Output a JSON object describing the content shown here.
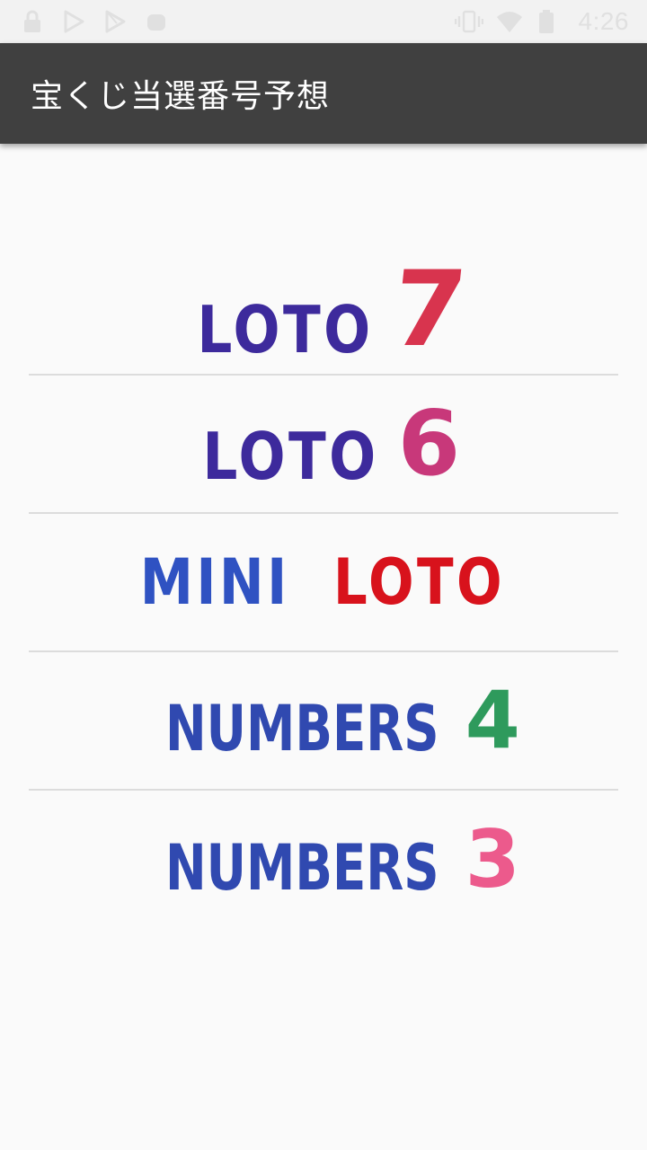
{
  "status_bar": {
    "time": "4:26",
    "left_icons": [
      "lock-icon",
      "play-store-icon",
      "play-store-icon",
      "android-icon"
    ],
    "right_icons": [
      "vibrate-icon",
      "wifi-icon",
      "battery-icon"
    ],
    "icon_color": "#e0e0e0"
  },
  "app_bar": {
    "title": "宝くじ当選番号予想",
    "background": "#404040"
  },
  "menu": {
    "items": [
      {
        "id": "loto7",
        "word": "LOTO",
        "suffix": "7",
        "word_color": "#3d2a9c",
        "suffix_color": "#d8344e"
      },
      {
        "id": "loto6",
        "word": "LOTO",
        "suffix": "6",
        "word_color": "#3d2a9c",
        "suffix_color": "#c8387a"
      },
      {
        "id": "miniloto",
        "word": "MINI",
        "suffix": "LOTO",
        "word_color": "#2f52c2",
        "suffix_color": "#d8121c"
      },
      {
        "id": "numbers4",
        "word": "NUMBERS",
        "suffix": "4",
        "word_color": "#3049b0",
        "suffix_color": "#2e9a5c"
      },
      {
        "id": "numbers3",
        "word": "NUMBERS",
        "suffix": "3",
        "word_color": "#3049b0",
        "suffix_color": "#ec5a8c"
      }
    ],
    "divider_color": "#dcdcdc"
  }
}
